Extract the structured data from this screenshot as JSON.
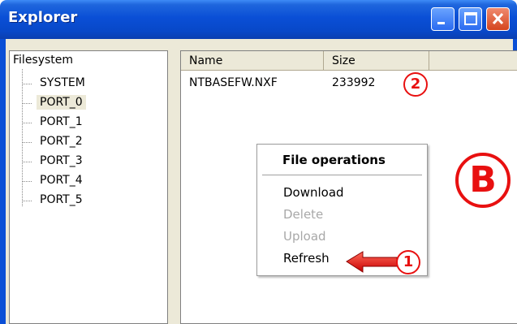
{
  "window": {
    "title": "Explorer"
  },
  "tree": {
    "root": "Filesystem",
    "items": [
      "SYSTEM",
      "PORT_0",
      "PORT_1",
      "PORT_2",
      "PORT_3",
      "PORT_4",
      "PORT_5"
    ],
    "selected": "PORT_0"
  },
  "list": {
    "columns": [
      "Name",
      "Size"
    ],
    "rows": [
      {
        "name": "NTBASEFW.NXF",
        "size": "233992"
      }
    ]
  },
  "context_menu": {
    "title": "File operations",
    "items": [
      {
        "label": "Download",
        "enabled": true
      },
      {
        "label": "Delete",
        "enabled": false
      },
      {
        "label": "Upload",
        "enabled": false
      },
      {
        "label": "Refresh",
        "enabled": true
      }
    ]
  },
  "annotations": {
    "marker_1": "1",
    "marker_2": "2",
    "marker_b": "B"
  },
  "colors": {
    "titlebar": "#0a4fd6",
    "annotation": "#e81010",
    "disabled_text": "#a8a8a8"
  }
}
